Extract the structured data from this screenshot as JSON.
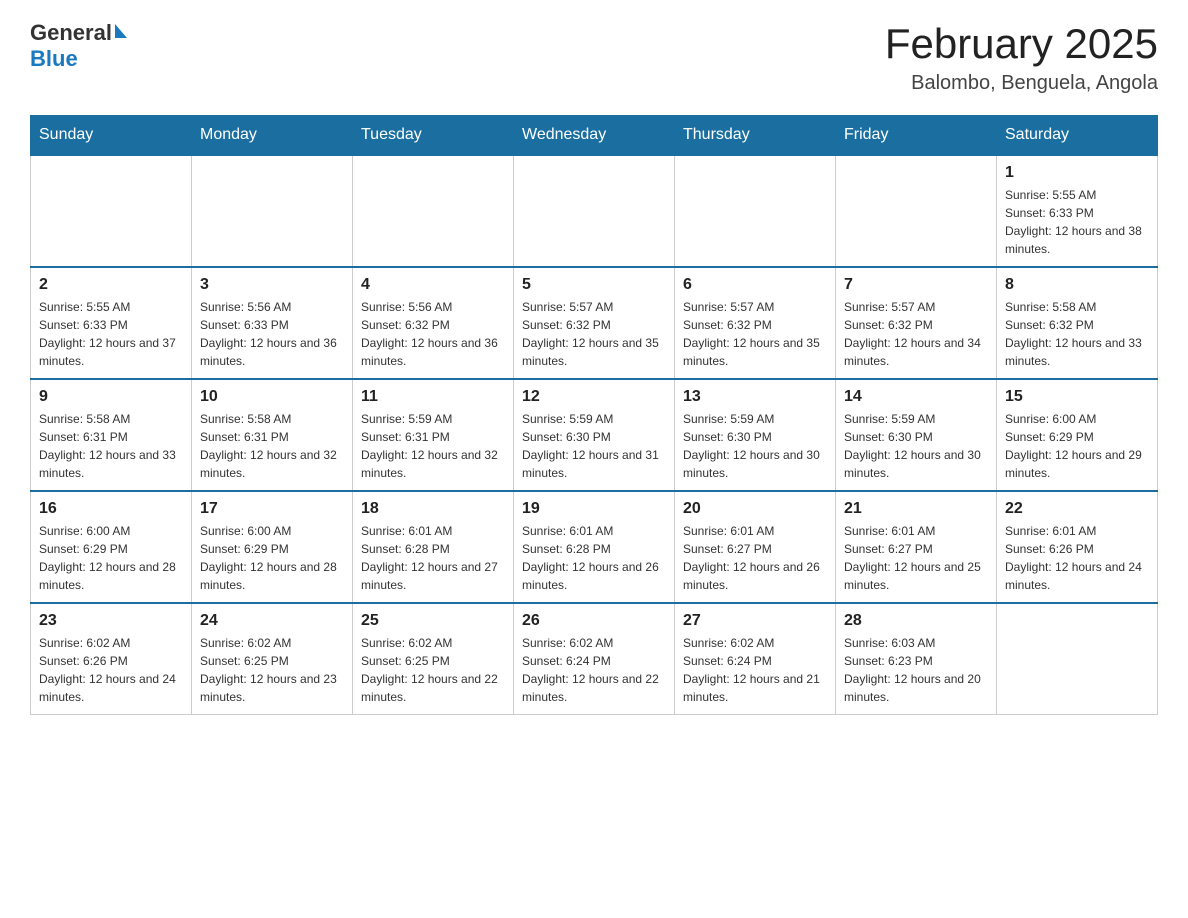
{
  "header": {
    "logo_general": "General",
    "logo_blue": "Blue",
    "month_title": "February 2025",
    "location": "Balombo, Benguela, Angola"
  },
  "days_of_week": [
    "Sunday",
    "Monday",
    "Tuesday",
    "Wednesday",
    "Thursday",
    "Friday",
    "Saturday"
  ],
  "weeks": [
    [
      {
        "day": "",
        "info": ""
      },
      {
        "day": "",
        "info": ""
      },
      {
        "day": "",
        "info": ""
      },
      {
        "day": "",
        "info": ""
      },
      {
        "day": "",
        "info": ""
      },
      {
        "day": "",
        "info": ""
      },
      {
        "day": "1",
        "info": "Sunrise: 5:55 AM\nSunset: 6:33 PM\nDaylight: 12 hours and 38 minutes."
      }
    ],
    [
      {
        "day": "2",
        "info": "Sunrise: 5:55 AM\nSunset: 6:33 PM\nDaylight: 12 hours and 37 minutes."
      },
      {
        "day": "3",
        "info": "Sunrise: 5:56 AM\nSunset: 6:33 PM\nDaylight: 12 hours and 36 minutes."
      },
      {
        "day": "4",
        "info": "Sunrise: 5:56 AM\nSunset: 6:32 PM\nDaylight: 12 hours and 36 minutes."
      },
      {
        "day": "5",
        "info": "Sunrise: 5:57 AM\nSunset: 6:32 PM\nDaylight: 12 hours and 35 minutes."
      },
      {
        "day": "6",
        "info": "Sunrise: 5:57 AM\nSunset: 6:32 PM\nDaylight: 12 hours and 35 minutes."
      },
      {
        "day": "7",
        "info": "Sunrise: 5:57 AM\nSunset: 6:32 PM\nDaylight: 12 hours and 34 minutes."
      },
      {
        "day": "8",
        "info": "Sunrise: 5:58 AM\nSunset: 6:32 PM\nDaylight: 12 hours and 33 minutes."
      }
    ],
    [
      {
        "day": "9",
        "info": "Sunrise: 5:58 AM\nSunset: 6:31 PM\nDaylight: 12 hours and 33 minutes."
      },
      {
        "day": "10",
        "info": "Sunrise: 5:58 AM\nSunset: 6:31 PM\nDaylight: 12 hours and 32 minutes."
      },
      {
        "day": "11",
        "info": "Sunrise: 5:59 AM\nSunset: 6:31 PM\nDaylight: 12 hours and 32 minutes."
      },
      {
        "day": "12",
        "info": "Sunrise: 5:59 AM\nSunset: 6:30 PM\nDaylight: 12 hours and 31 minutes."
      },
      {
        "day": "13",
        "info": "Sunrise: 5:59 AM\nSunset: 6:30 PM\nDaylight: 12 hours and 30 minutes."
      },
      {
        "day": "14",
        "info": "Sunrise: 5:59 AM\nSunset: 6:30 PM\nDaylight: 12 hours and 30 minutes."
      },
      {
        "day": "15",
        "info": "Sunrise: 6:00 AM\nSunset: 6:29 PM\nDaylight: 12 hours and 29 minutes."
      }
    ],
    [
      {
        "day": "16",
        "info": "Sunrise: 6:00 AM\nSunset: 6:29 PM\nDaylight: 12 hours and 28 minutes."
      },
      {
        "day": "17",
        "info": "Sunrise: 6:00 AM\nSunset: 6:29 PM\nDaylight: 12 hours and 28 minutes."
      },
      {
        "day": "18",
        "info": "Sunrise: 6:01 AM\nSunset: 6:28 PM\nDaylight: 12 hours and 27 minutes."
      },
      {
        "day": "19",
        "info": "Sunrise: 6:01 AM\nSunset: 6:28 PM\nDaylight: 12 hours and 26 minutes."
      },
      {
        "day": "20",
        "info": "Sunrise: 6:01 AM\nSunset: 6:27 PM\nDaylight: 12 hours and 26 minutes."
      },
      {
        "day": "21",
        "info": "Sunrise: 6:01 AM\nSunset: 6:27 PM\nDaylight: 12 hours and 25 minutes."
      },
      {
        "day": "22",
        "info": "Sunrise: 6:01 AM\nSunset: 6:26 PM\nDaylight: 12 hours and 24 minutes."
      }
    ],
    [
      {
        "day": "23",
        "info": "Sunrise: 6:02 AM\nSunset: 6:26 PM\nDaylight: 12 hours and 24 minutes."
      },
      {
        "day": "24",
        "info": "Sunrise: 6:02 AM\nSunset: 6:25 PM\nDaylight: 12 hours and 23 minutes."
      },
      {
        "day": "25",
        "info": "Sunrise: 6:02 AM\nSunset: 6:25 PM\nDaylight: 12 hours and 22 minutes."
      },
      {
        "day": "26",
        "info": "Sunrise: 6:02 AM\nSunset: 6:24 PM\nDaylight: 12 hours and 22 minutes."
      },
      {
        "day": "27",
        "info": "Sunrise: 6:02 AM\nSunset: 6:24 PM\nDaylight: 12 hours and 21 minutes."
      },
      {
        "day": "28",
        "info": "Sunrise: 6:03 AM\nSunset: 6:23 PM\nDaylight: 12 hours and 20 minutes."
      },
      {
        "day": "",
        "info": ""
      }
    ]
  ]
}
